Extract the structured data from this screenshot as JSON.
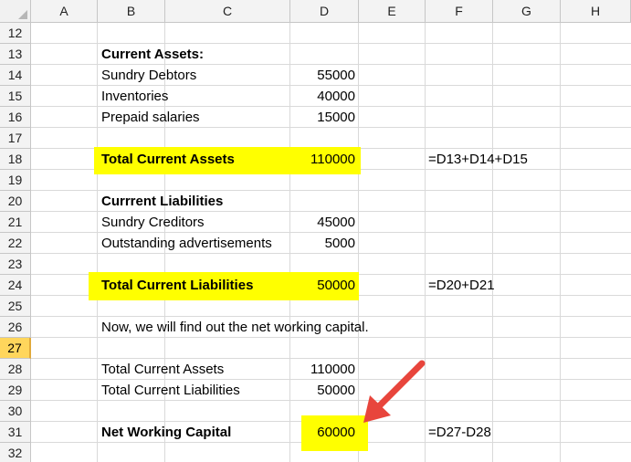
{
  "columns": [
    "A",
    "B",
    "C",
    "D",
    "E",
    "F",
    "G",
    "H"
  ],
  "rows": [
    "12",
    "13",
    "14",
    "15",
    "16",
    "17",
    "18",
    "19",
    "20",
    "21",
    "22",
    "23",
    "24",
    "25",
    "26",
    "27",
    "28",
    "29",
    "30",
    "31",
    "32"
  ],
  "active_row": "27",
  "cells": {
    "current_assets_heading": "Current Assets:",
    "sundry_debtors_label": "Sundry Debtors",
    "sundry_debtors_value": "55000",
    "inventories_label": "Inventories",
    "inventories_value": "40000",
    "prepaid_salaries_label": "Prepaid salaries",
    "prepaid_salaries_value": "15000",
    "total_current_assets_label": "Total Current Assets",
    "total_current_assets_value": "110000",
    "total_current_assets_formula": "=D13+D14+D15",
    "current_liabilities_heading": "Currrent Liabilities",
    "sundry_creditors_label": "Sundry Creditors",
    "sundry_creditors_value": "45000",
    "outstanding_ads_label": "Outstanding advertisements",
    "outstanding_ads_value": "5000",
    "total_current_liabilities_label": "Total Current Liabilities",
    "total_current_liabilities_value": "50000",
    "total_current_liabilities_formula": "=D20+D21",
    "note_text": "Now, we will find out the net working capital.",
    "summary_assets_label": "Total Current Assets",
    "summary_assets_value": "110000",
    "summary_liabilities_label": "Total Current Liabilities",
    "summary_liabilities_value": "50000",
    "net_working_capital_label": "Net Working Capital",
    "net_working_capital_value": "60000",
    "net_working_capital_formula": "=D27-D28"
  },
  "colors": {
    "highlight": "#ffff00",
    "arrow": "#e8453c",
    "active_row_header": "#ffd65c"
  },
  "icons": {
    "annotation_arrow": "red-arrow-icon",
    "select_all": "select-all-triangle-icon"
  }
}
